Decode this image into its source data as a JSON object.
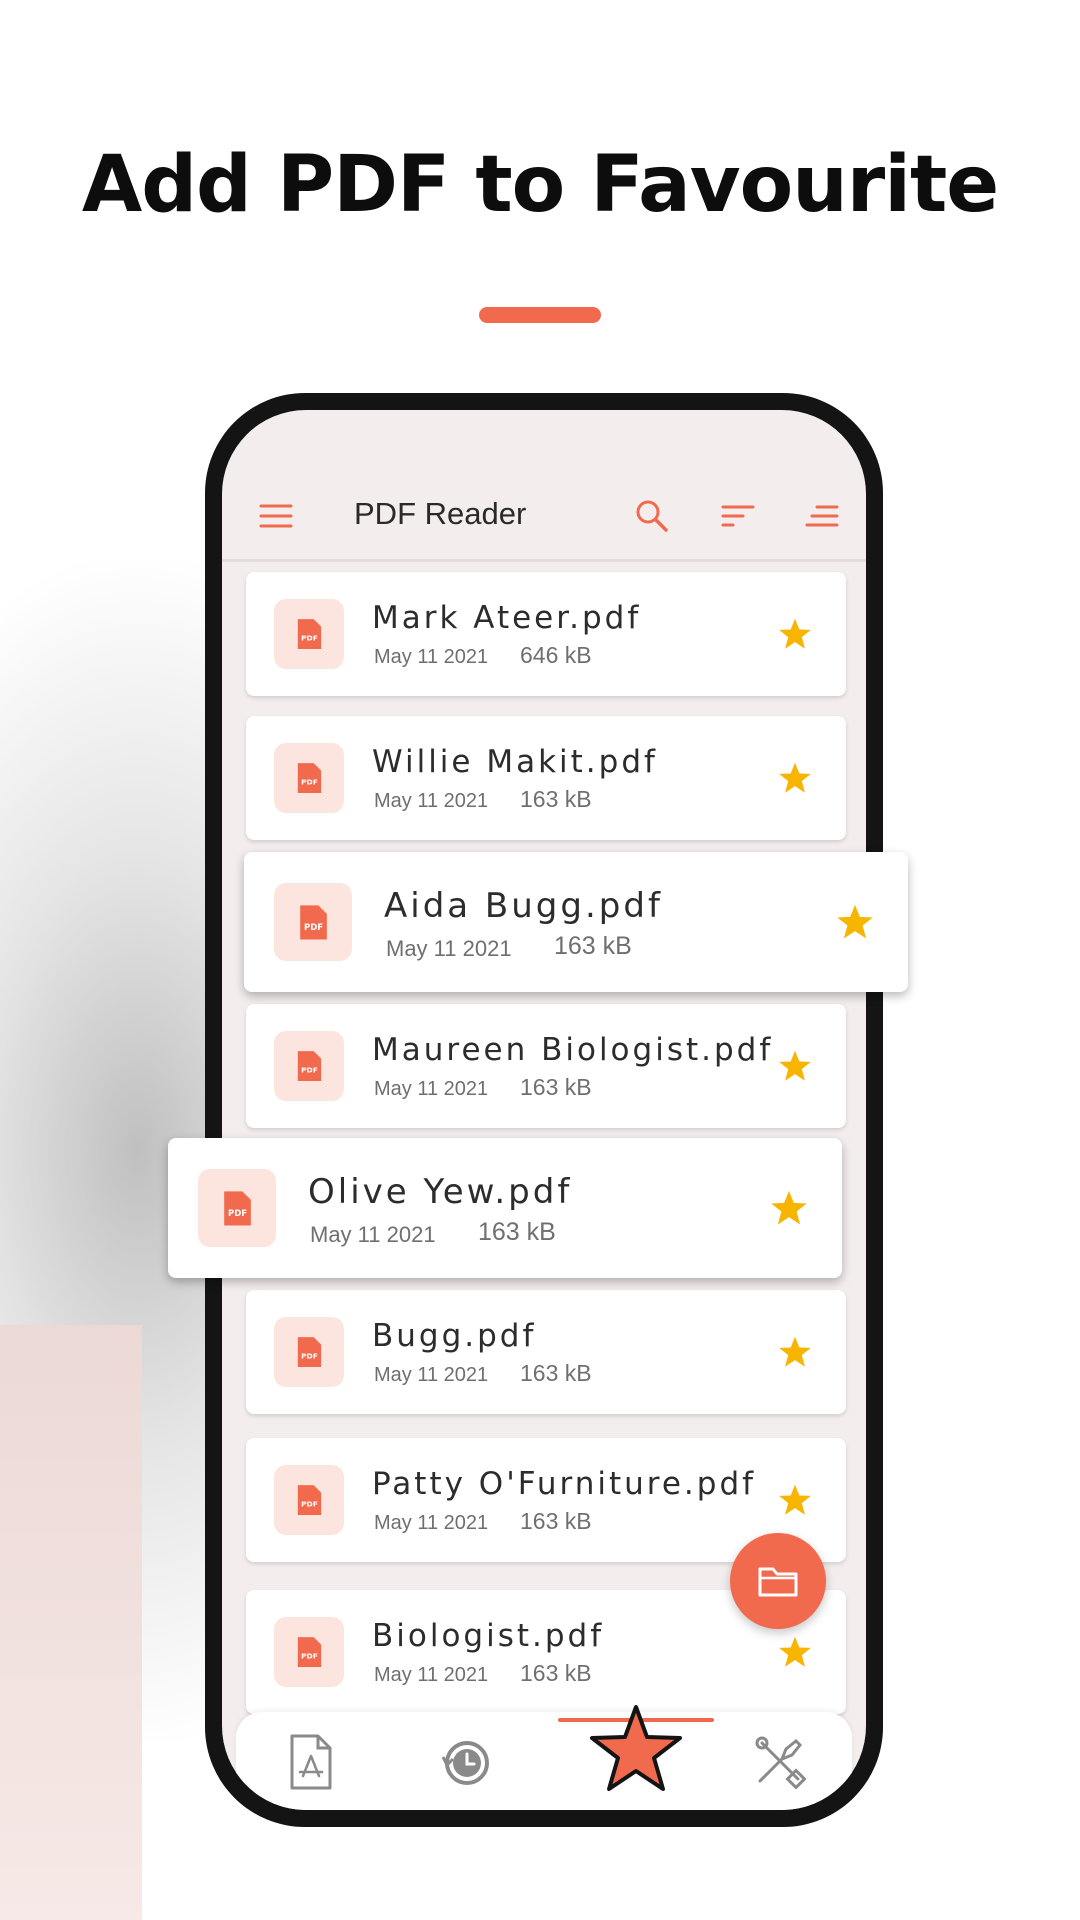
{
  "headline": "Add PDF to Favourite",
  "colors": {
    "accent": "#f26a4e",
    "star": "#f7b500",
    "icon_bg": "#fde5df"
  },
  "appbar": {
    "title": "PDF Reader",
    "icons": [
      "menu-icon",
      "search-icon",
      "sort-icon",
      "filter-icon"
    ]
  },
  "files": [
    {
      "name": "Mark Ateer.pdf",
      "date": "May 11 2021",
      "size": "646 kB",
      "favourite": true
    },
    {
      "name": "Willie Makit.pdf",
      "date": "May 11 2021",
      "size": "163 kB",
      "favourite": true
    },
    {
      "name": "Aida Bugg.pdf",
      "date": "May 11 2021",
      "size": "163 kB",
      "favourite": true
    },
    {
      "name": "Maureen Biologist.pdf",
      "date": "May 11 2021",
      "size": "163 kB",
      "favourite": true
    },
    {
      "name": "Olive Yew.pdf",
      "date": "May 11 2021",
      "size": "163 kB",
      "favourite": true
    },
    {
      "name": "Bugg.pdf",
      "date": "May 11 2021",
      "size": "163 kB",
      "favourite": true
    },
    {
      "name": "Patty O'Furniture.pdf",
      "date": "May 11 2021",
      "size": "163 kB",
      "favourite": true
    },
    {
      "name": "Biologist.pdf",
      "date": "May 11 2021",
      "size": "163 kB",
      "favourite": true
    }
  ],
  "pdf_icon_label": "PDF",
  "fab_icon": "folder-icon",
  "bottom_nav": {
    "items": [
      "pdf-file-icon",
      "history-icon",
      "favourite-star-icon",
      "tools-icon"
    ],
    "active": "favourite-star-icon"
  }
}
